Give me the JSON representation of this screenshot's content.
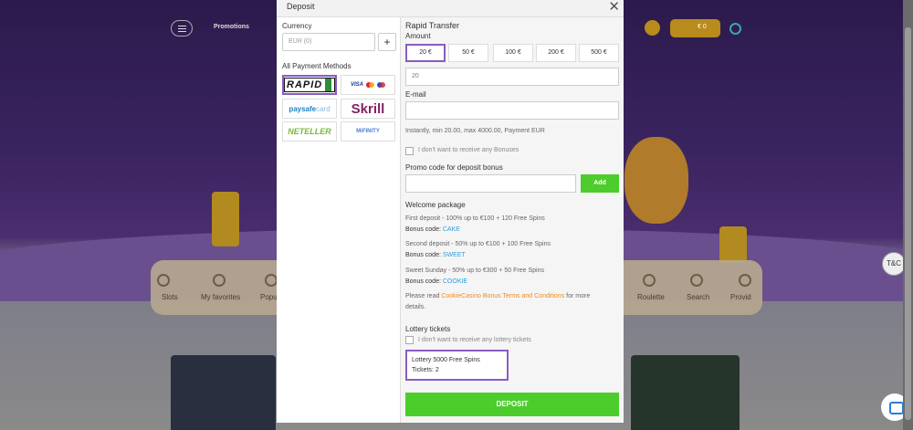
{
  "background": {
    "nav_promotions": "Promotions",
    "balance": "€ 0",
    "menu_items": [
      "Slots",
      "My favorites",
      "Popu",
      "Roulette",
      "Search",
      "Provid"
    ],
    "tc_label": "T&C"
  },
  "modal": {
    "title": "Deposit",
    "currency": {
      "label": "Currency",
      "value": "EUR (0)",
      "add": "+"
    },
    "payment_methods": {
      "label": "All Payment Methods",
      "items": [
        {
          "name": "RAPID",
          "selected": true
        },
        {
          "name": "VISA"
        },
        {
          "name": "paysafecard",
          "part1": "paysafe",
          "part2": "card"
        },
        {
          "name": "Skrill"
        },
        {
          "name": "NETELLER"
        },
        {
          "name": "MiFINITY"
        }
      ]
    },
    "right": {
      "method_title": "Rapid Transfer",
      "amount_label": "Amount",
      "amounts": [
        "20 €",
        "50 €",
        "100 €",
        "200 €",
        "500 €"
      ],
      "selected_amount_index": 0,
      "amount_value": "20",
      "email_label": "E-mail",
      "email_value": "",
      "limits": "Instantly, min 20.00, max 4000.00, Payment EUR",
      "no_bonus": "I don't want to receive any Bonuses",
      "promo_label": "Promo code for deposit bonus",
      "promo_value": "",
      "add_label": "Add",
      "welcome_title": "Welcome package",
      "bonuses": [
        {
          "desc": "First deposit - 100% up to €100 + 120 Free Spins",
          "code_label": "Bonus code:",
          "code": "CAKE"
        },
        {
          "desc": "Second deposit - 50% up to €100 + 100 Free Spins",
          "code_label": "Bonus code:",
          "code": "SWEET"
        },
        {
          "desc": "Sweet Sunday - 50% up to €300 + 50 Free Spins",
          "code_label": "Bonus code:",
          "code": "COOKIE"
        }
      ],
      "read_prefix": "Please read",
      "terms_link": "CookieCasino Bonus Terms and Conditions",
      "read_suffix": "for more",
      "read_suffix2": "details.",
      "lottery_title": "Lottery tickets",
      "no_lottery": "I don't want to receive any lottery tickets",
      "lottery_card": {
        "name": "Lottery 5000 Free Spins",
        "tickets_label": "Tickets:",
        "tickets": "2"
      },
      "deposit_label": "DEPOSIT"
    }
  },
  "colors": {
    "accent_green": "#4ccd2c",
    "selected_border": "#8a5cc0",
    "link_blue": "#2f9fd8",
    "link_orange": "#f08a1c"
  }
}
